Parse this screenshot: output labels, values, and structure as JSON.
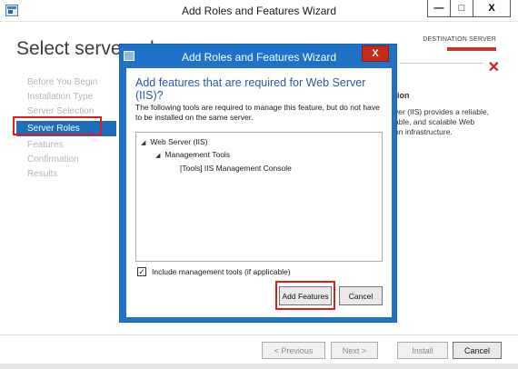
{
  "outer": {
    "title": "Add Roles and Features Wizard",
    "page_title": "Select server roles",
    "destination_label": "DESTINATION SERVER",
    "window_buttons": {
      "minimize": "—",
      "maximize": "□",
      "close": "X"
    },
    "close_x": "✕"
  },
  "nav": {
    "items": [
      {
        "label": "Before You Begin"
      },
      {
        "label": "Installation Type"
      },
      {
        "label": "Server Selection"
      },
      {
        "label": "Server Roles"
      },
      {
        "label": "Features"
      },
      {
        "label": "Confirmation"
      },
      {
        "label": "Results"
      }
    ]
  },
  "description": {
    "heading": "tion",
    "line1": "ver (IIS) provides a reliable,",
    "line2": "able, and scalable Web",
    "line3": "on infrastructure."
  },
  "bottom": {
    "previous": "< Previous",
    "next": "Next >",
    "install": "Install",
    "cancel": "Cancel"
  },
  "modal": {
    "title": "Add Roles and Features Wizard",
    "close": "X",
    "heading": "Add features that are required for Web Server (IIS)?",
    "desc": "The following tools are required to manage this feature, but do not have to be installed on the same server.",
    "tree": {
      "root": "Web Server (IIS)",
      "child": "Management Tools",
      "leaf": "[Tools] IIS Management Console"
    },
    "include_tools_label": "Include management tools (if applicable)",
    "include_tools_checked": "✓",
    "add_features": "Add Features",
    "cancel": "Cancel"
  },
  "colors": {
    "accent": "#1e6db8",
    "modal_frame": "#1e73c9",
    "highlight_box": "#e11b1b",
    "close_red": "#c42b1c"
  }
}
